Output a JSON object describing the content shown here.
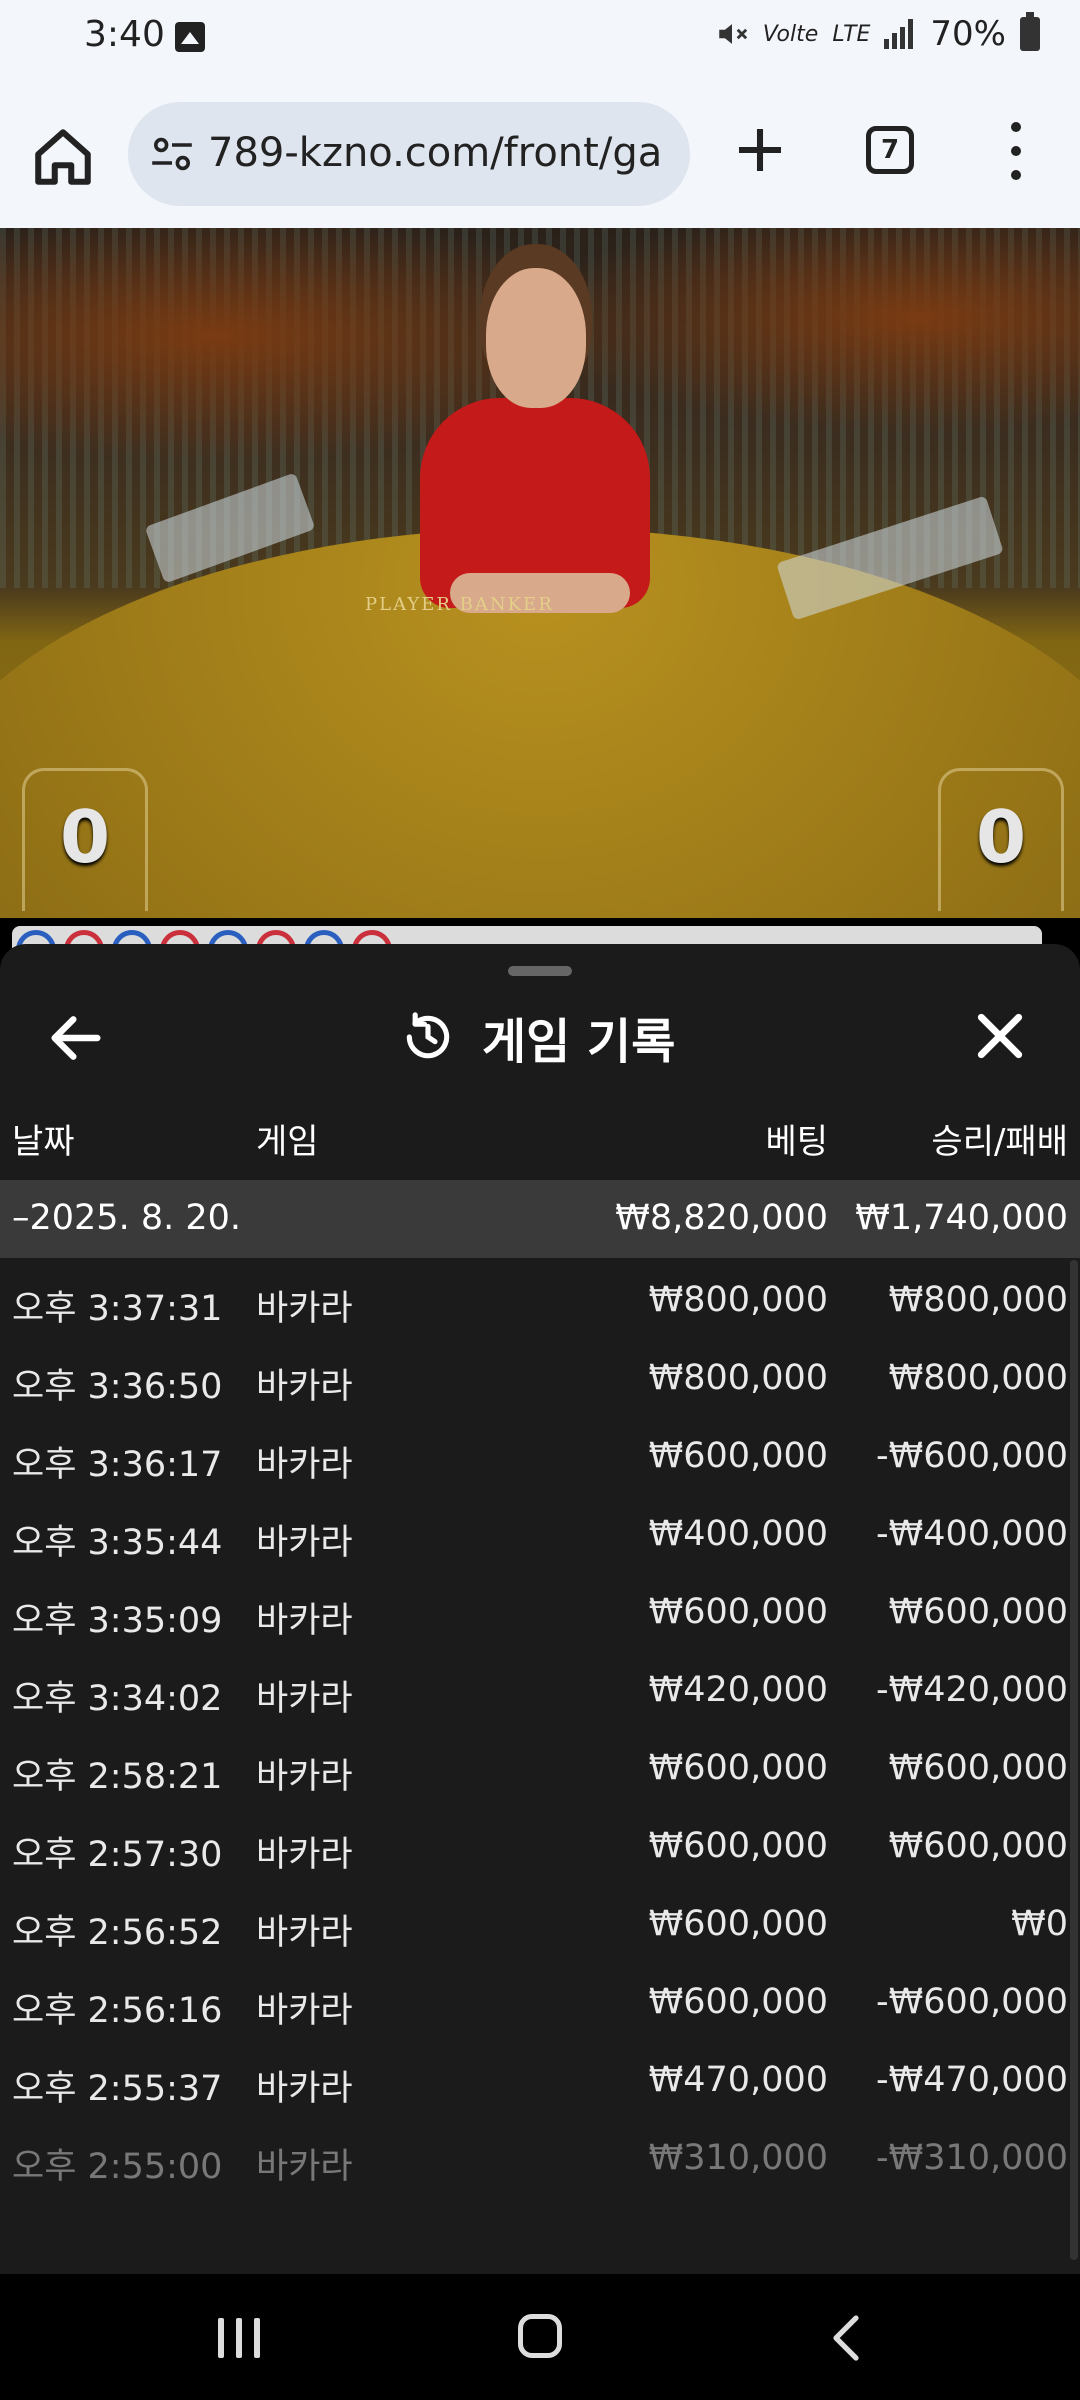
{
  "status_bar": {
    "time": "3:40",
    "volte": "Vo",
    "volte_sub": "lte",
    "lte": "LTE",
    "battery": "70%"
  },
  "browser": {
    "url": "789-kzno.com/front/ga",
    "tab_count": "7"
  },
  "video": {
    "table_text": "PLAYER        BANKER",
    "player_score": "0",
    "banker_score": "0"
  },
  "history_panel": {
    "title": "게임 기록",
    "columns": {
      "date": "날짜",
      "game": "게임",
      "bet": "베팅",
      "win_loss": "승리/패배"
    },
    "date_group": {
      "date": "–2025. 8. 20.",
      "total_bet": "₩8,820,000",
      "total_win_loss": "₩1,740,000"
    },
    "rows": [
      {
        "time": "오후 3:37:31",
        "game": "바카라",
        "bet": "₩800,000",
        "win_loss": "₩800,000"
      },
      {
        "time": "오후 3:36:50",
        "game": "바카라",
        "bet": "₩800,000",
        "win_loss": "₩800,000"
      },
      {
        "time": "오후 3:36:17",
        "game": "바카라",
        "bet": "₩600,000",
        "win_loss": "-₩600,000"
      },
      {
        "time": "오후 3:35:44",
        "game": "바카라",
        "bet": "₩400,000",
        "win_loss": "-₩400,000"
      },
      {
        "time": "오후 3:35:09",
        "game": "바카라",
        "bet": "₩600,000",
        "win_loss": "₩600,000"
      },
      {
        "time": "오후 3:34:02",
        "game": "바카라",
        "bet": "₩420,000",
        "win_loss": "-₩420,000"
      },
      {
        "time": "오후 2:58:21",
        "game": "바카라",
        "bet": "₩600,000",
        "win_loss": "₩600,000"
      },
      {
        "time": "오후 2:57:30",
        "game": "바카라",
        "bet": "₩600,000",
        "win_loss": "₩600,000"
      },
      {
        "time": "오후 2:56:52",
        "game": "바카라",
        "bet": "₩600,000",
        "win_loss": "₩0"
      },
      {
        "time": "오후 2:56:16",
        "game": "바카라",
        "bet": "₩600,000",
        "win_loss": "-₩600,000"
      },
      {
        "time": "오후 2:55:37",
        "game": "바카라",
        "bet": "₩470,000",
        "win_loss": "-₩470,000"
      },
      {
        "time": "오후 2:55:00",
        "game": "바카라",
        "bet": "₩310,000",
        "win_loss": "-₩310,000"
      }
    ]
  },
  "icons": {
    "home": "home-icon",
    "site_settings": "tune-icon",
    "new_tab": "plus-icon",
    "menu": "more-vertical-icon",
    "back": "arrow-left-icon",
    "history": "history-icon",
    "close": "close-icon"
  }
}
